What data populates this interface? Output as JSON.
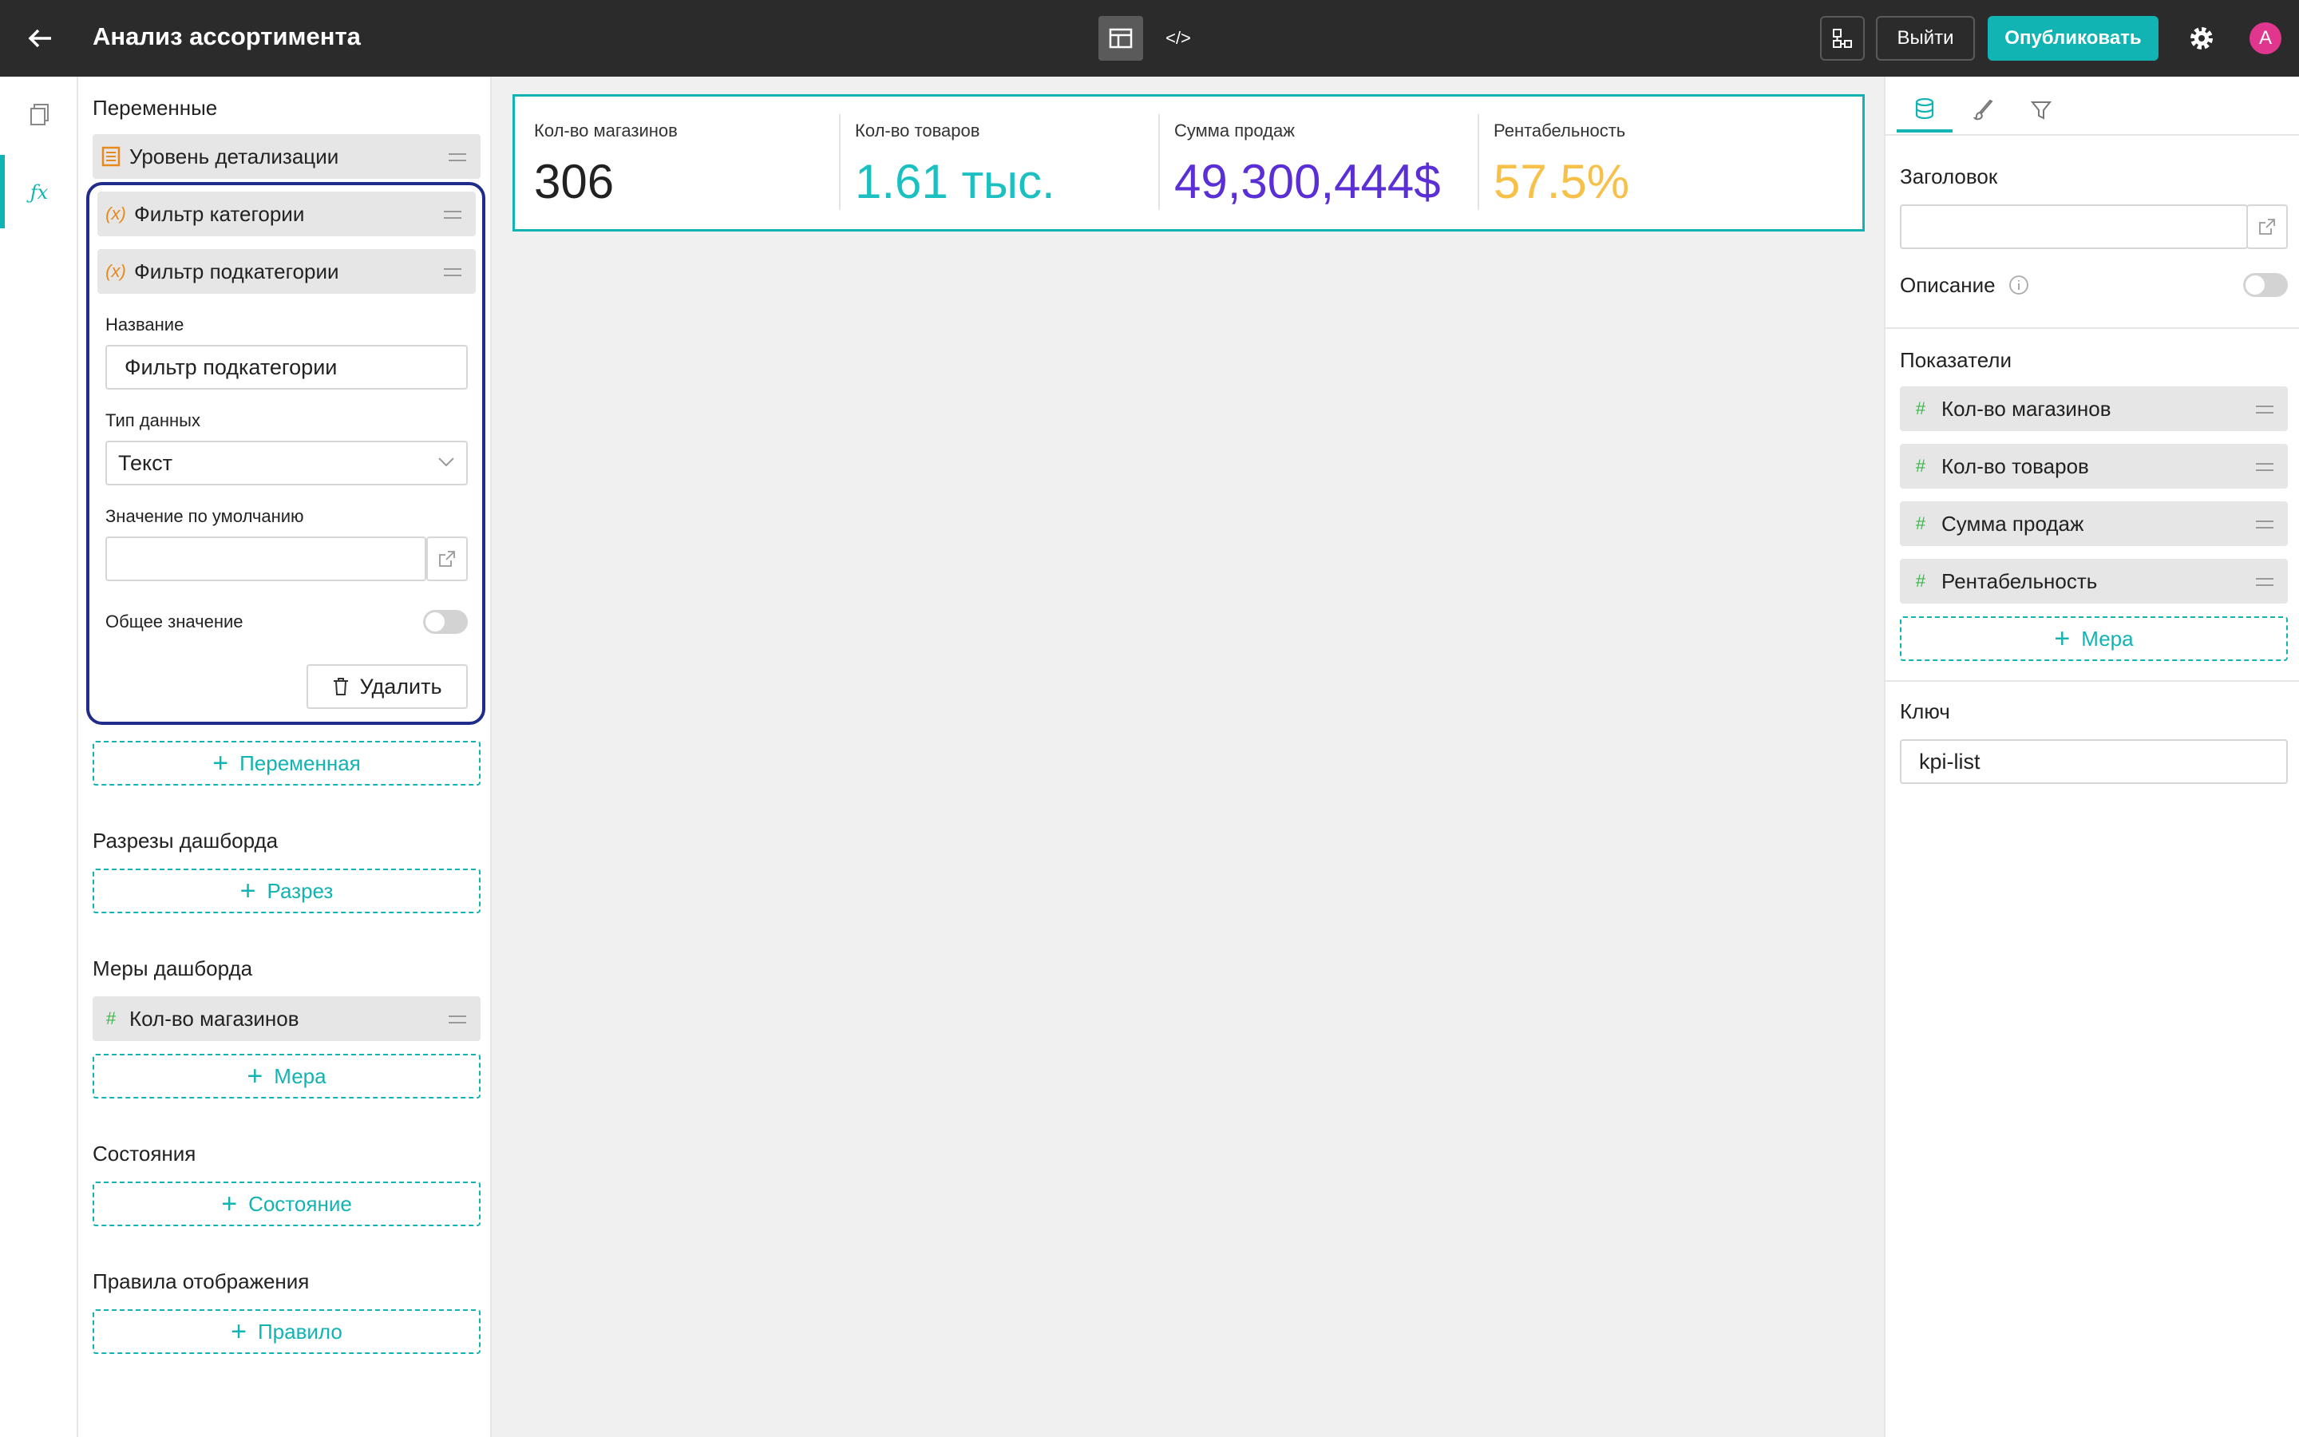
{
  "header": {
    "title": "Анализ ассортимента",
    "logout_label": "Выйти",
    "publish_label": "Опубликовать",
    "avatar_letter": "A",
    "code_view_label": "</>"
  },
  "left": {
    "variables_title": "Переменные",
    "variables": [
      {
        "label": "Уровень детализации",
        "icon": "list-icon"
      },
      {
        "label": "Фильтр категории",
        "icon": "(x)"
      },
      {
        "label": "Фильтр подкатегории",
        "icon": "(x)"
      }
    ],
    "form": {
      "name_label": "Название",
      "name_value": "Фильтр подкатегории",
      "type_label": "Тип данных",
      "type_value": "Текст",
      "default_label": "Значение по умолчанию",
      "default_value": "",
      "shared_label": "Общее значение",
      "shared_on": false,
      "delete_label": "Удалить"
    },
    "add_variable": "Переменная",
    "slices_title": "Разрезы дашборда",
    "add_slice": "Разрез",
    "measures_title": "Меры дашборда",
    "measures": [
      "Кол-во магазинов"
    ],
    "add_measure": "Мера",
    "states_title": "Состояния",
    "add_state": "Состояние",
    "rules_title": "Правила отображения",
    "add_rule": "Правило"
  },
  "kpis": [
    {
      "label": "Кол-во магазинов",
      "value": "306",
      "color": "#222222"
    },
    {
      "label": "Кол-во товаров",
      "value": "1.61 тыс.",
      "color": "#1cc0c0"
    },
    {
      "label": "Сумма продаж",
      "value": "49,300,444$",
      "color": "#5b2fd6"
    },
    {
      "label": "Рентабельность",
      "value": "57.5%",
      "color": "#f7c04a"
    }
  ],
  "right": {
    "title_label": "Заголовок",
    "title_value": "",
    "description_label": "Описание",
    "description_on": false,
    "indicators_title": "Показатели",
    "indicators": [
      "Кол-во магазинов",
      "Кол-во товаров",
      "Сумма продаж",
      "Рентабельность"
    ],
    "add_measure": "Мера",
    "key_label": "Ключ",
    "key_value": "kpi-list"
  },
  "colors": {
    "accent": "#12b3b3",
    "highlight_border": "#1f2c8c",
    "topbar": "#2b2b2b"
  }
}
